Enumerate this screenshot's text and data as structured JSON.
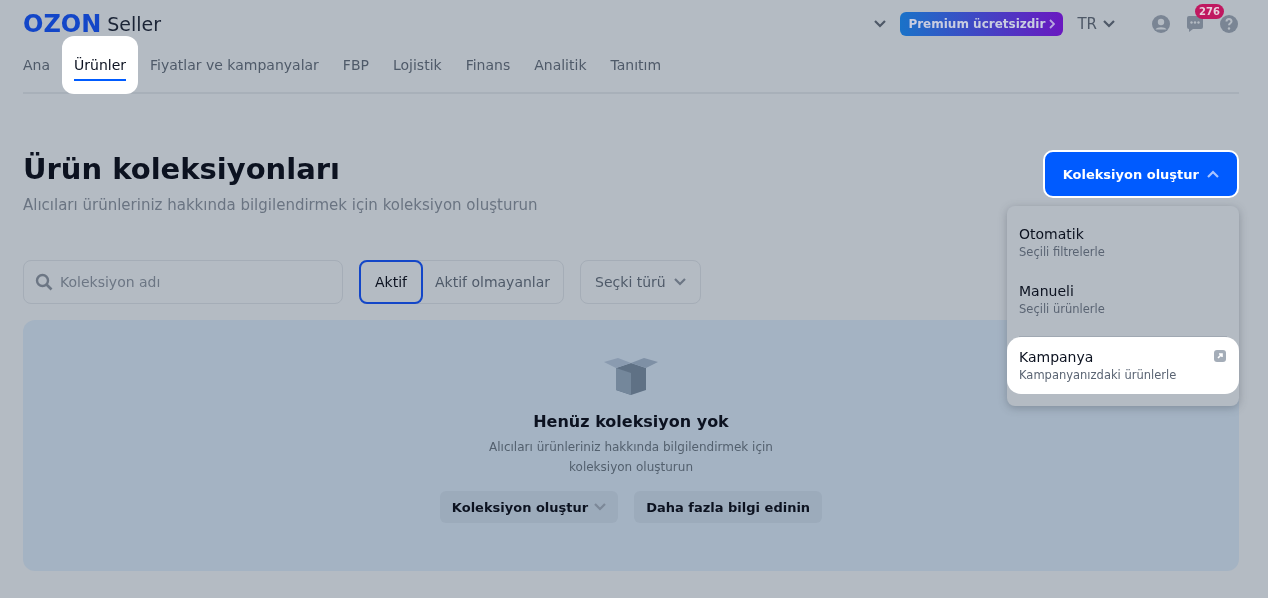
{
  "header": {
    "logo": "OZON",
    "logo_suffix": "Seller",
    "premium": "Premium ücretsizdir",
    "language": "TR",
    "messages_badge": "276"
  },
  "tabs": [
    {
      "label": "Ana",
      "selected": false,
      "highlighted": false
    },
    {
      "label": "Ürünler",
      "selected": true,
      "highlighted": true
    },
    {
      "label": "Fiyatlar ve kampanyalar",
      "selected": false,
      "highlighted": false
    },
    {
      "label": "FBP",
      "selected": false,
      "highlighted": false
    },
    {
      "label": "Lojistik",
      "selected": false,
      "highlighted": false
    },
    {
      "label": "Finans",
      "selected": false,
      "highlighted": false
    },
    {
      "label": "Analitik",
      "selected": false,
      "highlighted": false
    },
    {
      "label": "Tanıtım",
      "selected": false,
      "highlighted": false
    }
  ],
  "page": {
    "title": "Ürün koleksiyonları",
    "subtitle": "Alıcıları ürünleriniz hakkında bilgilendirmek için koleksiyon oluşturun",
    "create_button": "Koleksiyon oluştur",
    "create_expanded": true
  },
  "filters": {
    "search": {
      "placeholder": "Koleksiyon adı"
    },
    "status": [
      {
        "label": "Aktif",
        "selected": true
      },
      {
        "label": "Aktif olmayanlar",
        "selected": false
      }
    ],
    "type_dropdown": "Seçki türü"
  },
  "menu": [
    {
      "title": "Otomatik",
      "subtitle": "Seçili filtrelerle",
      "highlighted": false,
      "external": false
    },
    {
      "title": "Manueli",
      "subtitle": "Seçili ürünlerle",
      "highlighted": false,
      "external": false
    },
    {
      "title": "Kampanya",
      "subtitle": "Kampanyanızdaki ürünlerle",
      "highlighted": true,
      "external": true
    }
  ],
  "empty_state": {
    "title": "Henüz koleksiyon yok",
    "text": "Alıcıları ürünleriniz hakkında bilgilendirmek için koleksiyon oluşturun",
    "buttons": [
      "Koleksiyon oluştur",
      "Daha fazla bilgi edinin"
    ]
  }
}
